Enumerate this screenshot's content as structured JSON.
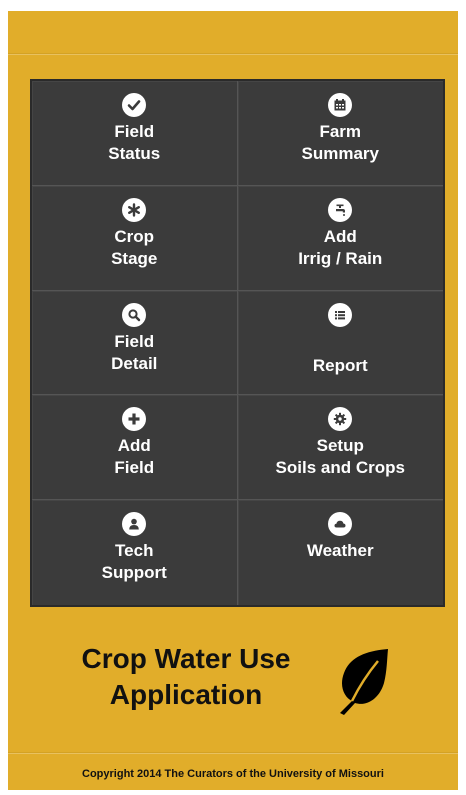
{
  "menu": {
    "tiles": [
      {
        "label": "Field\nStatus",
        "icon": "check-icon"
      },
      {
        "label": "Farm\nSummary",
        "icon": "calendar-icon"
      },
      {
        "label": "Crop\nStage",
        "icon": "asterisk-icon"
      },
      {
        "label": "Add\nIrrig / Rain",
        "icon": "faucet-icon"
      },
      {
        "label": "Field\nDetail",
        "icon": "search-icon"
      },
      {
        "label": "Report",
        "icon": "list-icon"
      },
      {
        "label": "Add\nField",
        "icon": "plus-icon"
      },
      {
        "label": "Setup\nSoils and Crops",
        "icon": "gear-icon"
      },
      {
        "label": "Tech\nSupport",
        "icon": "user-icon"
      },
      {
        "label": "Weather",
        "icon": "cloud-icon"
      }
    ]
  },
  "branding": {
    "title": "Crop Water Use\nApplication",
    "logo_icon": "leaf-icon"
  },
  "footer": {
    "copyright": "Copyright  2014 The Curators of the University of Missouri"
  },
  "colors": {
    "background": "#E1AD2A",
    "tile": "#3b3b3b",
    "text": "#ffffff"
  }
}
